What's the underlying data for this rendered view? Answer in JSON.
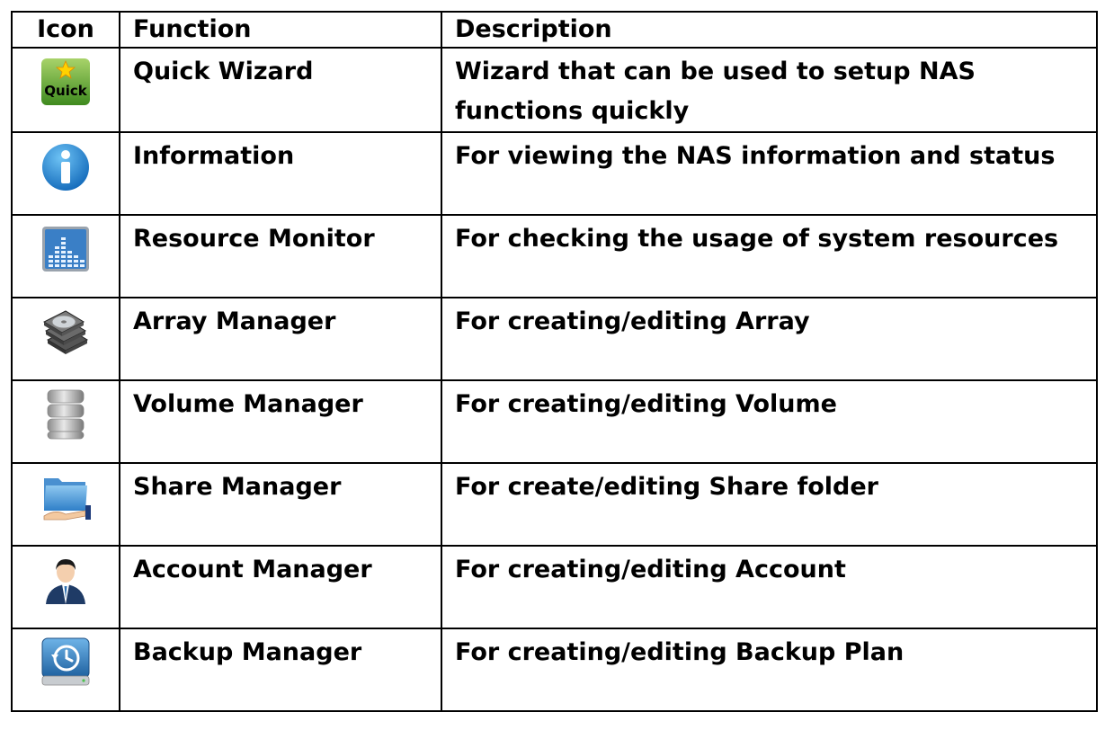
{
  "table": {
    "headers": {
      "icon": "Icon",
      "function": "Function",
      "description": "Description"
    },
    "rows": [
      {
        "icon": "quick-wizard-icon",
        "function": "Quick Wizard",
        "description": "Wizard that can be used to setup NAS functions quickly"
      },
      {
        "icon": "information-icon",
        "function": "Information",
        "description": "For viewing the NAS information and status"
      },
      {
        "icon": "resource-monitor-icon",
        "function": "Resource Monitor",
        "description": "For checking the usage of system resources"
      },
      {
        "icon": "array-manager-icon",
        "function": "Array Manager",
        "description": "For creating/editing Array"
      },
      {
        "icon": "volume-manager-icon",
        "function": "Volume Manager",
        "description": "For creating/editing Volume"
      },
      {
        "icon": "share-manager-icon",
        "function": "Share Manager",
        "description": "For create/editing Share folder"
      },
      {
        "icon": "account-manager-icon",
        "function": "Account Manager",
        "description": "For creating/editing Account"
      },
      {
        "icon": "backup-manager-icon",
        "function": "Backup Manager",
        "description": "For creating/editing Backup Plan"
      }
    ],
    "quick_icon_text": "Quick"
  }
}
